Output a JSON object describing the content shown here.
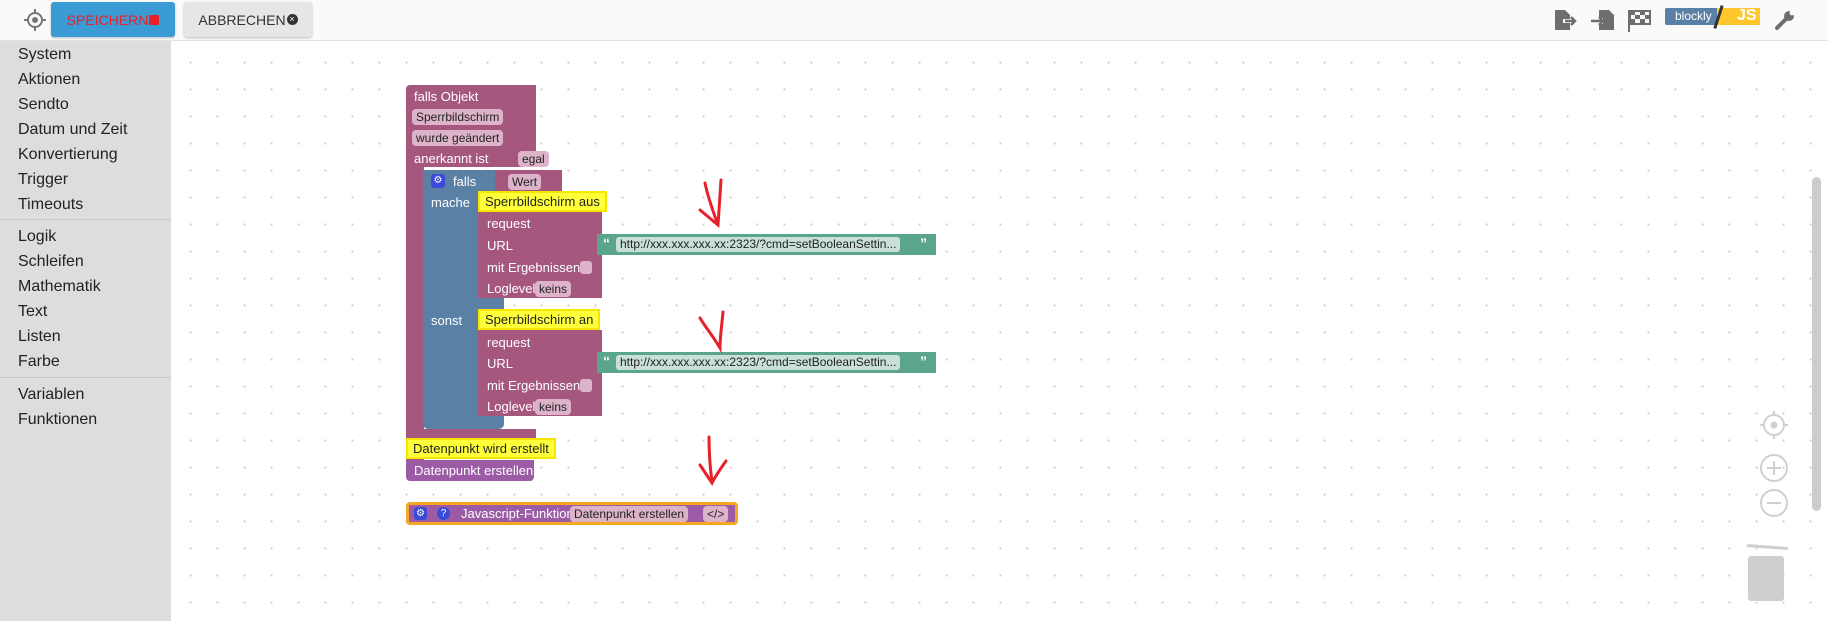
{
  "toolbar": {
    "save_label": "SPEICHERN",
    "cancel_label": "ABBRECHEN",
    "blockly_label": "blockly",
    "js_label": "JS"
  },
  "sidebar": {
    "items": [
      {
        "label": "System"
      },
      {
        "label": "Aktionen"
      },
      {
        "label": "Sendto"
      },
      {
        "label": "Datum und Zeit"
      },
      {
        "label": "Konvertierung"
      },
      {
        "label": "Trigger"
      },
      {
        "label": "Timeouts"
      },
      {
        "label": "Logik"
      },
      {
        "label": "Schleifen"
      },
      {
        "label": "Mathematik"
      },
      {
        "label": "Text"
      },
      {
        "label": "Listen"
      },
      {
        "label": "Farbe"
      },
      {
        "label": "Variablen"
      },
      {
        "label": "Funktionen"
      }
    ]
  },
  "blocks": {
    "trigger": {
      "title": "falls Objekt",
      "object": "Sperrbildschirm",
      "event": "wurde geändert",
      "ack_label": "anerkannt ist",
      "ack_value": "egal"
    },
    "if": {
      "falls": "falls",
      "cond": "Wert",
      "mache": "mache",
      "sonst": "sonst"
    },
    "req1": {
      "comment": "Sperrbildschirm aus",
      "request": "request",
      "url_label": "URL",
      "url": "http://xxx.xxx.xxx.xx:2323/?cmd=setBooleanSettin...",
      "results": "mit Ergebnissen",
      "loglevel_label": "Loglevel",
      "loglevel": "keins"
    },
    "req2": {
      "comment": "Sperrbildschirm an",
      "request": "request",
      "url_label": "URL",
      "url": "http://xxx.xxx.xxx.xx:2323/?cmd=setBooleanSettin...",
      "results": "mit Ergebnissen",
      "loglevel_label": "Loglevel",
      "loglevel": "keins"
    },
    "create": {
      "comment": "Datenpunkt wird erstellt",
      "label": "Datenpunkt erstellen"
    },
    "jsfunc": {
      "label": "Javascript-Funktion",
      "name": "Datenpunkt erstellen",
      "code": "</>"
    }
  },
  "colors": {
    "event": "#a5577e",
    "logic": "#5b80a5",
    "text": "#5ba58c",
    "function": "#9b5ba5",
    "comment": "#ffff3a",
    "annotation": "#e8202a",
    "save_button": "#3a9bd5"
  }
}
